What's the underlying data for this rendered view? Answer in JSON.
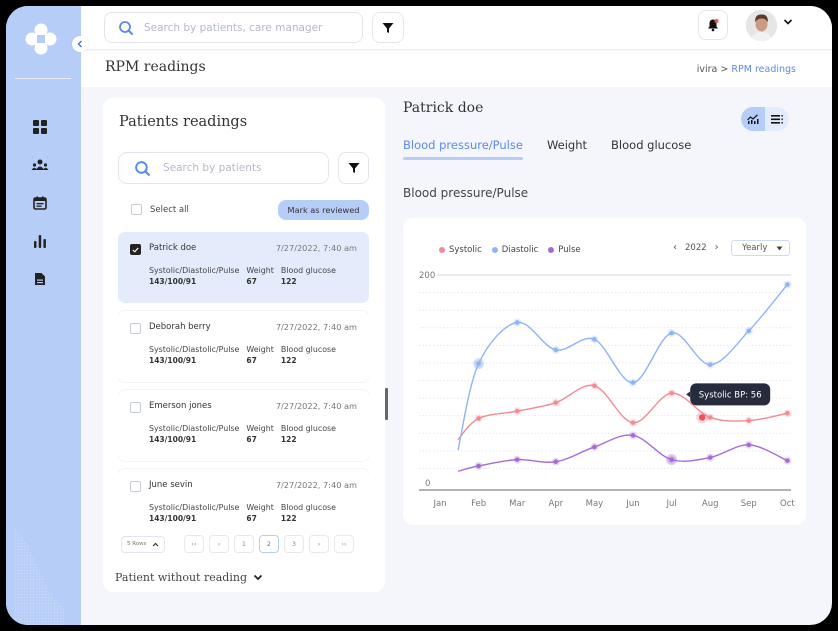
{
  "app": {
    "search_placeholder": "Search by patients, care manager",
    "page_title": "RPM readings",
    "breadcrumb": {
      "root": "ivira",
      "separator": ">",
      "current": "RPM readings"
    }
  },
  "sidebar": {
    "items": [
      {
        "name": "dashboard",
        "icon": "grid-icon"
      },
      {
        "name": "patients",
        "icon": "users-icon"
      },
      {
        "name": "calendar",
        "icon": "calendar-icon"
      },
      {
        "name": "reports",
        "icon": "bar-chart-icon"
      },
      {
        "name": "documents",
        "icon": "document-icon"
      }
    ]
  },
  "left_panel": {
    "title": "Patients readings",
    "search_placeholder": "Search by patients",
    "select_all_label": "Select all",
    "mark_reviewed_label": "Mark as reviewed",
    "patients": [
      {
        "name": "Patrick doe",
        "datetime": "7/27/2022, 7:40 am",
        "checked": true,
        "bp_label": "Systolic/Diastolic/Pulse",
        "bp_value": "143/100/91",
        "weight_label": "Weight",
        "weight_value": "67",
        "glucose_label": "Blood glucose",
        "glucose_value": "122"
      },
      {
        "name": "Deborah berry",
        "datetime": "7/27/2022, 7:40 am",
        "checked": false,
        "bp_label": "Systolic/Diastolic/Pulse",
        "bp_value": "143/100/91",
        "weight_label": "Weight",
        "weight_value": "67",
        "glucose_label": "Blood glucose",
        "glucose_value": "122"
      },
      {
        "name": "Emerson jones",
        "datetime": "7/27/2022, 7:40 am",
        "checked": false,
        "bp_label": "Systolic/Diastolic/Pulse",
        "bp_value": "143/100/91",
        "weight_label": "Weight",
        "weight_value": "67",
        "glucose_label": "Blood glucose",
        "glucose_value": "122"
      },
      {
        "name": "June sevin",
        "datetime": "7/27/2022, 7:40 am",
        "checked": false,
        "bp_label": "Systolic/Diastolic/Pulse",
        "bp_value": "143/100/91",
        "weight_label": "Weight",
        "weight_value": "67",
        "glucose_label": "Blood glucose",
        "glucose_value": "122"
      }
    ],
    "pagination": {
      "rows_label": "5 Rows",
      "first": "‹‹",
      "prev": "‹",
      "next": "›",
      "last": "››",
      "pages": [
        "1",
        "2",
        "3"
      ],
      "current_page": "2"
    },
    "without_reading_label": "Patient without reading"
  },
  "detail": {
    "patient_name": "Patrick doe",
    "tabs": [
      {
        "label": "Blood pressure/Pulse",
        "active": true
      },
      {
        "label": "Weight",
        "active": false
      },
      {
        "label": "Blood glucose",
        "active": false
      }
    ],
    "section_title": "Blood pressure/Pulse",
    "year": "2022",
    "period": "Yearly",
    "tooltip": "Systolic BP: 56",
    "colors": {
      "accent": "#5b8ae6",
      "accent_light": "#b6cdf7"
    }
  },
  "chart_data": {
    "type": "line",
    "title": "Blood pressure/Pulse",
    "xlabel": "",
    "ylabel": "",
    "ylim": [
      0,
      200
    ],
    "y_ticks": [
      "0",
      "200"
    ],
    "categories": [
      "Jan",
      "Feb",
      "Mar",
      "Apr",
      "May",
      "Jun",
      "Jul",
      "Aug",
      "Sep",
      "Oct"
    ],
    "legend_position": "top-left",
    "grid": true,
    "series": [
      {
        "name": "Systolic",
        "color": "#f28b95",
        "values": [
          null,
          64,
          71,
          79,
          95,
          60,
          88,
          65,
          62,
          69
        ]
      },
      {
        "name": "Diastolic",
        "color": "#8fb4f5",
        "values": [
          null,
          116,
          155,
          129,
          139,
          98,
          145,
          115,
          147,
          191
        ]
      },
      {
        "name": "Pulse",
        "color": "#a66bd6",
        "values": [
          null,
          19,
          25,
          23,
          37,
          48,
          25,
          27,
          39,
          24
        ]
      }
    ],
    "tooltip": {
      "series": "Systolic",
      "category": "Aug",
      "label": "Systolic BP: 56"
    }
  }
}
